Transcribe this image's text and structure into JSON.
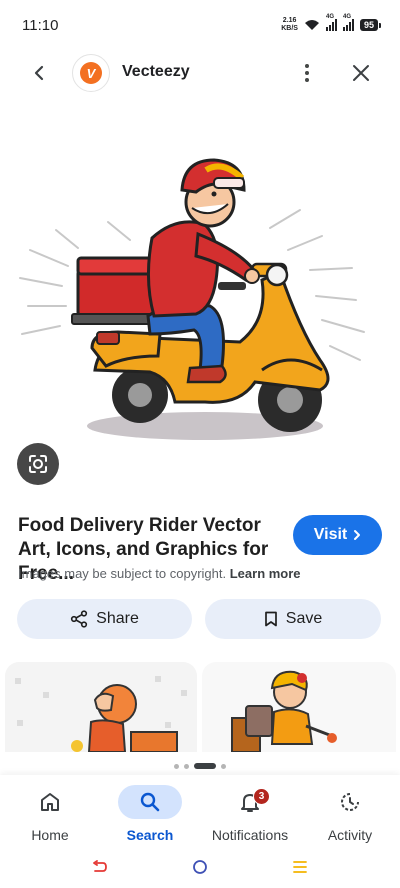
{
  "status_bar": {
    "time": "11:10",
    "net_speed_value": "2.16",
    "net_speed_unit": "KB/S",
    "network_1": "4G",
    "network_2": "4G",
    "battery": "95"
  },
  "header": {
    "site_name": "Vecteezy",
    "logo_letter": "V"
  },
  "result": {
    "title": "Food Delivery Rider Vector Art, Icons, and Graphics for Free...",
    "visit_label": "Visit",
    "copyright_text": "Images may be subject to copyright.",
    "learn_more": "Learn more"
  },
  "actions": {
    "share_label": "Share",
    "save_label": "Save"
  },
  "bottom_nav": {
    "items": [
      {
        "label": "Home",
        "icon": "home-icon"
      },
      {
        "label": "Search",
        "icon": "search-icon"
      },
      {
        "label": "Notifications",
        "icon": "bell-icon",
        "badge": "3"
      },
      {
        "label": "Activity",
        "icon": "activity-icon"
      }
    ],
    "active_index": 1
  },
  "colors": {
    "accent": "#1a73e8",
    "active_nav_bg": "#d3e3fd",
    "action_bg": "#e8eef9",
    "brand_logo": "#f37021",
    "badge": "#b3261e"
  }
}
